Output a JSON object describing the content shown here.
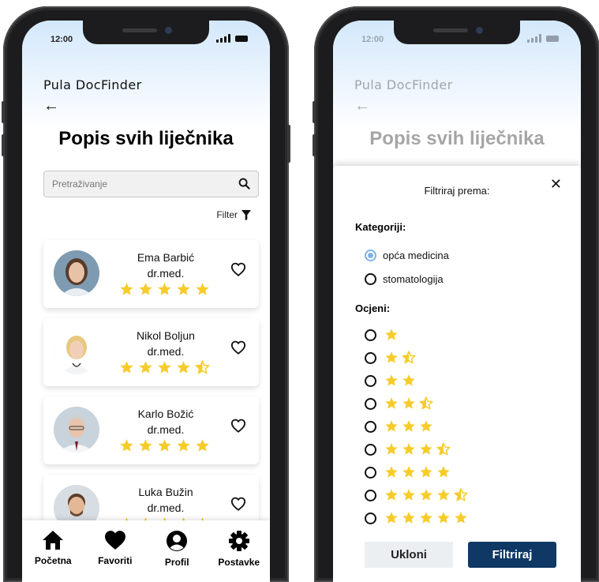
{
  "status_bar": {
    "time": "12:00"
  },
  "app": {
    "title": "Pula DocFinder",
    "page_title": "Popis svih liječnika"
  },
  "search": {
    "placeholder": "Pretraživanje"
  },
  "filter": {
    "label": "Filter"
  },
  "doctors": [
    {
      "name": "Ema Barbić",
      "title": "dr.med.",
      "rating": 5
    },
    {
      "name": "Nikol Boljun",
      "title": "dr.med.",
      "rating": 4.5
    },
    {
      "name": "Karlo Božić",
      "title": "dr.med.",
      "rating": 5
    },
    {
      "name": "Luka Bužin",
      "title": "dr.med.",
      "rating": 5
    }
  ],
  "nav": {
    "items": [
      {
        "label": "Početna",
        "icon": "home-icon"
      },
      {
        "label": "Favoriti",
        "icon": "heart-icon"
      },
      {
        "label": "Profil",
        "icon": "user-icon"
      },
      {
        "label": "Postavke",
        "icon": "gear-icon"
      }
    ]
  },
  "filter_sheet": {
    "title": "Filtriraj prema:",
    "category_label": "Kategoriji:",
    "categories": [
      {
        "label": "opća medicina",
        "selected": true
      },
      {
        "label": "stomatologija",
        "selected": false
      }
    ],
    "rating_label": "Ocjeni:",
    "ratings": [
      1,
      1.5,
      2,
      2.5,
      3,
      3.5,
      4,
      4.5,
      5
    ],
    "remove_label": "Ukloni",
    "apply_label": "Filtriraj"
  },
  "colors": {
    "star": "#f6cc2b",
    "primary_button": "#0f3865",
    "secondary_button": "#eceff2",
    "header_gradient": "#d3e8fb",
    "selected_radio": "#7fb3e6"
  }
}
